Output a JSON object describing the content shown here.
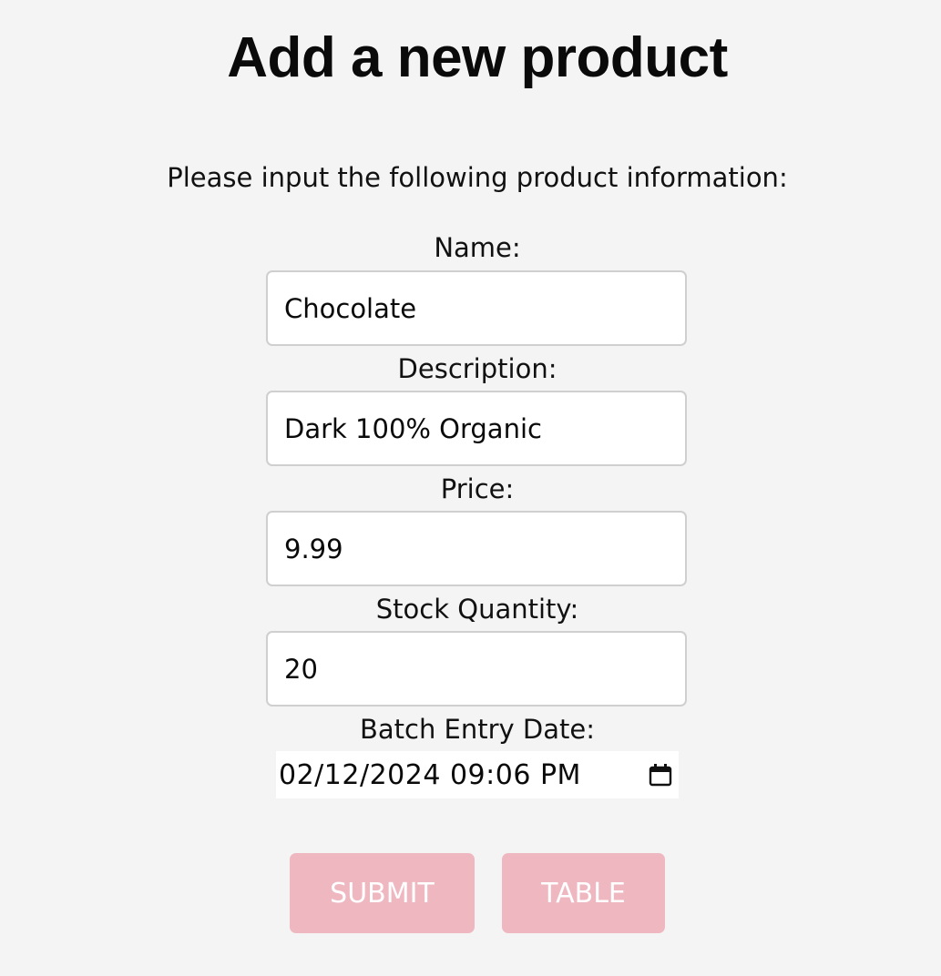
{
  "page": {
    "title": "Add a new product",
    "instructions": "Please input the following product information:"
  },
  "form": {
    "name": {
      "label": "Name:",
      "value": "Chocolate"
    },
    "description": {
      "label": "Description:",
      "value": "Dark 100% Organic"
    },
    "price": {
      "label": "Price:",
      "value": "9.99"
    },
    "stock_quantity": {
      "label": "Stock Quantity:",
      "value": "20"
    },
    "batch_entry_date": {
      "label": "Batch Entry Date:",
      "value": "02/12/2024 09:06 PM",
      "icon": "calendar-icon"
    }
  },
  "actions": {
    "submit_label": "SUBMIT",
    "table_label": "TABLE"
  },
  "colors": {
    "background": "#f4f4f4",
    "button": "#efb8c1",
    "button_text": "#ffffff",
    "input_border": "#cfcfcf"
  }
}
